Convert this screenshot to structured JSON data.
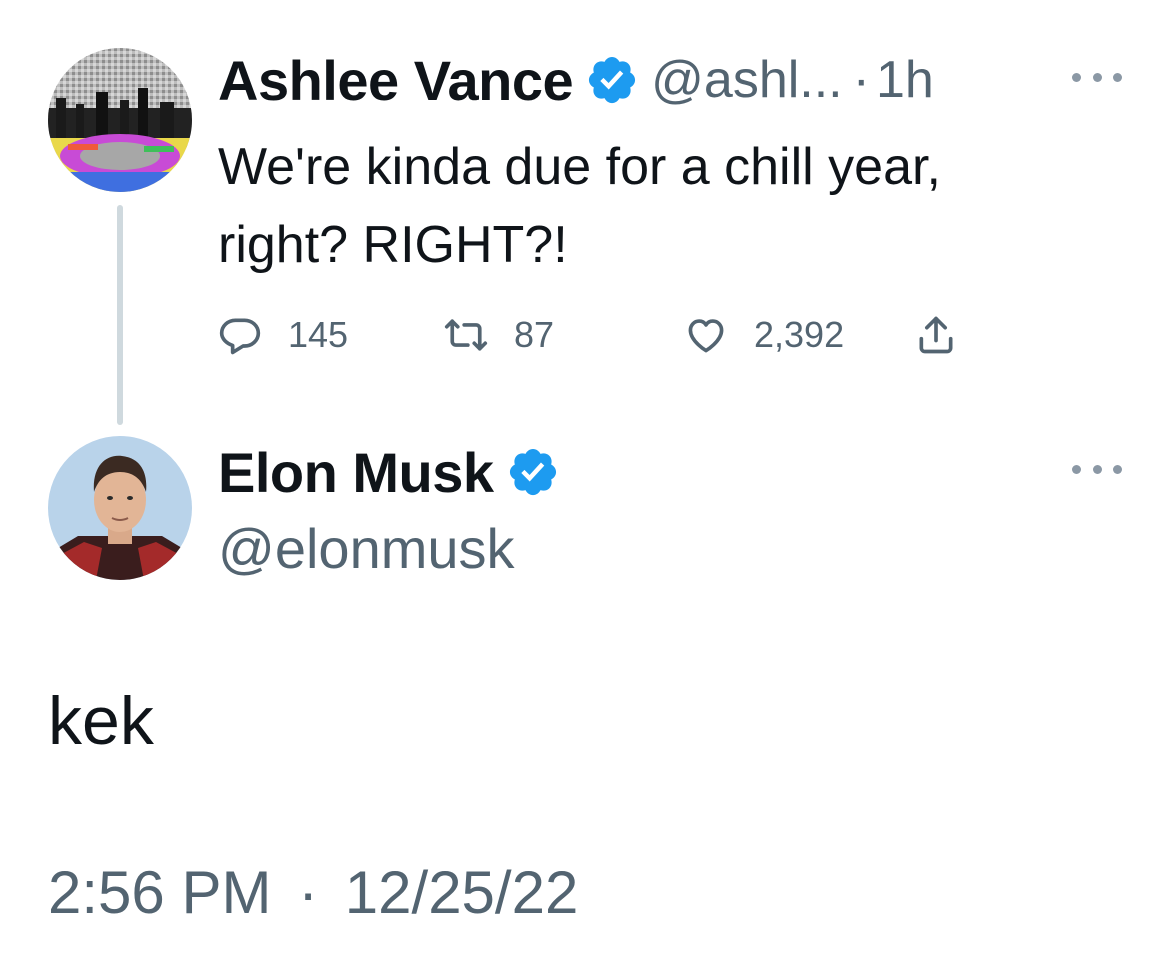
{
  "parent_tweet": {
    "author_name": "Ashlee Vance",
    "handle": "@ashl...",
    "separator": "·",
    "time_ago": "1h",
    "text_line1": "We're kinda due for a chill year,",
    "text_line2": "right? RIGHT?!",
    "stats": {
      "replies": "145",
      "retweets": "87",
      "likes": "2,392"
    },
    "verified": true
  },
  "main_tweet": {
    "author_name": "Elon Musk",
    "handle": "@elonmusk",
    "verified": true,
    "text": "kek",
    "time": "2:56 PM",
    "separator": "·",
    "date": "12/25/22"
  },
  "icons": {
    "reply": "reply-icon",
    "retweet": "retweet-icon",
    "like": "heart-icon",
    "share": "share-icon",
    "more": "more-icon",
    "verified": "verified-badge-icon"
  },
  "colors": {
    "verified_blue": "#1d9bf0",
    "secondary_text": "#536471",
    "primary_text": "#0f1419",
    "thread_line": "#cfd9de"
  }
}
